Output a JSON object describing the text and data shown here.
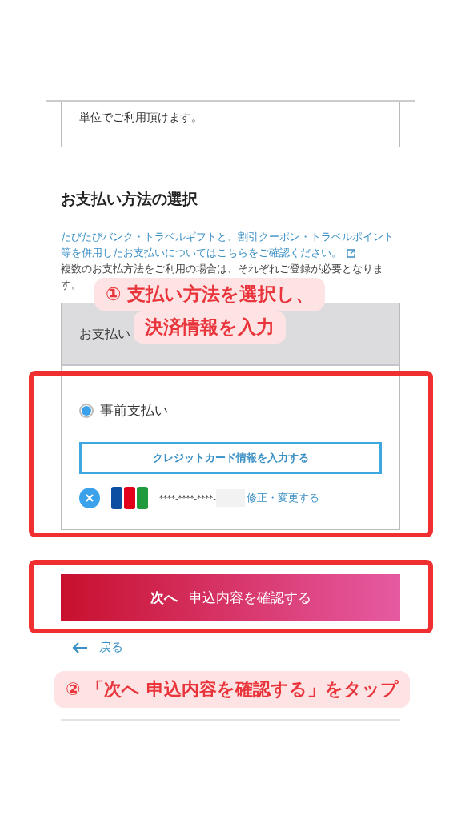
{
  "intro_box": {
    "text": "単位でご利用頂けます。"
  },
  "section": {
    "heading": "お支払い方法の選択",
    "link": "たびたびバンク・トラベルギフトと、割引クーポン・トラベルポイント等を併用したお支払いについてはこちらをご確認ください。",
    "note": "複数のお支払方法をご利用の場合は、それぞれご登録が必要となります。"
  },
  "payment_panel": {
    "header": "お支払い",
    "options": [
      {
        "label": "事前支払い",
        "selected": true
      }
    ],
    "card_button": "クレジットカード情報を入力する",
    "card": {
      "number": "****-****-****-",
      "edit_link": "修正・変更する"
    }
  },
  "next_button": {
    "strong": "次へ",
    "label": "申込内容を確認する"
  },
  "back_link": "戻る",
  "annotations": [
    {
      "lines": [
        "① 支払い方法を選択し、",
        "決済情報を入力"
      ]
    },
    {
      "lines": [
        "② 「次へ 申込内容を確認する」をタップ"
      ]
    }
  ]
}
